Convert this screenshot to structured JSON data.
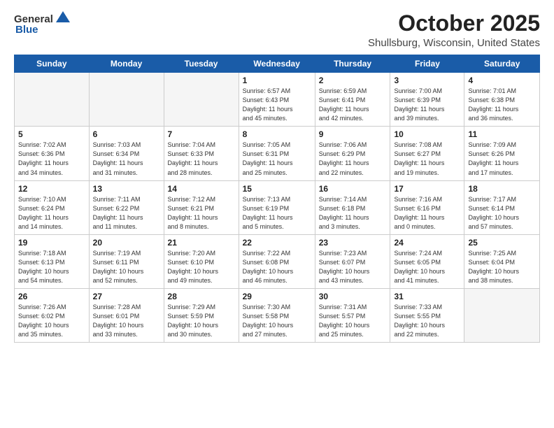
{
  "header": {
    "logo_general": "General",
    "logo_blue": "Blue",
    "month": "October 2025",
    "location": "Shullsburg, Wisconsin, United States"
  },
  "days_of_week": [
    "Sunday",
    "Monday",
    "Tuesday",
    "Wednesday",
    "Thursday",
    "Friday",
    "Saturday"
  ],
  "weeks": [
    [
      {
        "day": "",
        "info": "",
        "empty": true
      },
      {
        "day": "",
        "info": "",
        "empty": true
      },
      {
        "day": "",
        "info": "",
        "empty": true
      },
      {
        "day": "1",
        "info": "Sunrise: 6:57 AM\nSunset: 6:43 PM\nDaylight: 11 hours\nand 45 minutes.",
        "empty": false
      },
      {
        "day": "2",
        "info": "Sunrise: 6:59 AM\nSunset: 6:41 PM\nDaylight: 11 hours\nand 42 minutes.",
        "empty": false
      },
      {
        "day": "3",
        "info": "Sunrise: 7:00 AM\nSunset: 6:39 PM\nDaylight: 11 hours\nand 39 minutes.",
        "empty": false
      },
      {
        "day": "4",
        "info": "Sunrise: 7:01 AM\nSunset: 6:38 PM\nDaylight: 11 hours\nand 36 minutes.",
        "empty": false
      }
    ],
    [
      {
        "day": "5",
        "info": "Sunrise: 7:02 AM\nSunset: 6:36 PM\nDaylight: 11 hours\nand 34 minutes.",
        "empty": false
      },
      {
        "day": "6",
        "info": "Sunrise: 7:03 AM\nSunset: 6:34 PM\nDaylight: 11 hours\nand 31 minutes.",
        "empty": false
      },
      {
        "day": "7",
        "info": "Sunrise: 7:04 AM\nSunset: 6:33 PM\nDaylight: 11 hours\nand 28 minutes.",
        "empty": false
      },
      {
        "day": "8",
        "info": "Sunrise: 7:05 AM\nSunset: 6:31 PM\nDaylight: 11 hours\nand 25 minutes.",
        "empty": false
      },
      {
        "day": "9",
        "info": "Sunrise: 7:06 AM\nSunset: 6:29 PM\nDaylight: 11 hours\nand 22 minutes.",
        "empty": false
      },
      {
        "day": "10",
        "info": "Sunrise: 7:08 AM\nSunset: 6:27 PM\nDaylight: 11 hours\nand 19 minutes.",
        "empty": false
      },
      {
        "day": "11",
        "info": "Sunrise: 7:09 AM\nSunset: 6:26 PM\nDaylight: 11 hours\nand 17 minutes.",
        "empty": false
      }
    ],
    [
      {
        "day": "12",
        "info": "Sunrise: 7:10 AM\nSunset: 6:24 PM\nDaylight: 11 hours\nand 14 minutes.",
        "empty": false
      },
      {
        "day": "13",
        "info": "Sunrise: 7:11 AM\nSunset: 6:22 PM\nDaylight: 11 hours\nand 11 minutes.",
        "empty": false
      },
      {
        "day": "14",
        "info": "Sunrise: 7:12 AM\nSunset: 6:21 PM\nDaylight: 11 hours\nand 8 minutes.",
        "empty": false
      },
      {
        "day": "15",
        "info": "Sunrise: 7:13 AM\nSunset: 6:19 PM\nDaylight: 11 hours\nand 5 minutes.",
        "empty": false
      },
      {
        "day": "16",
        "info": "Sunrise: 7:14 AM\nSunset: 6:18 PM\nDaylight: 11 hours\nand 3 minutes.",
        "empty": false
      },
      {
        "day": "17",
        "info": "Sunrise: 7:16 AM\nSunset: 6:16 PM\nDaylight: 11 hours\nand 0 minutes.",
        "empty": false
      },
      {
        "day": "18",
        "info": "Sunrise: 7:17 AM\nSunset: 6:14 PM\nDaylight: 10 hours\nand 57 minutes.",
        "empty": false
      }
    ],
    [
      {
        "day": "19",
        "info": "Sunrise: 7:18 AM\nSunset: 6:13 PM\nDaylight: 10 hours\nand 54 minutes.",
        "empty": false
      },
      {
        "day": "20",
        "info": "Sunrise: 7:19 AM\nSunset: 6:11 PM\nDaylight: 10 hours\nand 52 minutes.",
        "empty": false
      },
      {
        "day": "21",
        "info": "Sunrise: 7:20 AM\nSunset: 6:10 PM\nDaylight: 10 hours\nand 49 minutes.",
        "empty": false
      },
      {
        "day": "22",
        "info": "Sunrise: 7:22 AM\nSunset: 6:08 PM\nDaylight: 10 hours\nand 46 minutes.",
        "empty": false
      },
      {
        "day": "23",
        "info": "Sunrise: 7:23 AM\nSunset: 6:07 PM\nDaylight: 10 hours\nand 43 minutes.",
        "empty": false
      },
      {
        "day": "24",
        "info": "Sunrise: 7:24 AM\nSunset: 6:05 PM\nDaylight: 10 hours\nand 41 minutes.",
        "empty": false
      },
      {
        "day": "25",
        "info": "Sunrise: 7:25 AM\nSunset: 6:04 PM\nDaylight: 10 hours\nand 38 minutes.",
        "empty": false
      }
    ],
    [
      {
        "day": "26",
        "info": "Sunrise: 7:26 AM\nSunset: 6:02 PM\nDaylight: 10 hours\nand 35 minutes.",
        "empty": false
      },
      {
        "day": "27",
        "info": "Sunrise: 7:28 AM\nSunset: 6:01 PM\nDaylight: 10 hours\nand 33 minutes.",
        "empty": false
      },
      {
        "day": "28",
        "info": "Sunrise: 7:29 AM\nSunset: 5:59 PM\nDaylight: 10 hours\nand 30 minutes.",
        "empty": false
      },
      {
        "day": "29",
        "info": "Sunrise: 7:30 AM\nSunset: 5:58 PM\nDaylight: 10 hours\nand 27 minutes.",
        "empty": false
      },
      {
        "day": "30",
        "info": "Sunrise: 7:31 AM\nSunset: 5:57 PM\nDaylight: 10 hours\nand 25 minutes.",
        "empty": false
      },
      {
        "day": "31",
        "info": "Sunrise: 7:33 AM\nSunset: 5:55 PM\nDaylight: 10 hours\nand 22 minutes.",
        "empty": false
      },
      {
        "day": "",
        "info": "",
        "empty": true
      }
    ]
  ]
}
